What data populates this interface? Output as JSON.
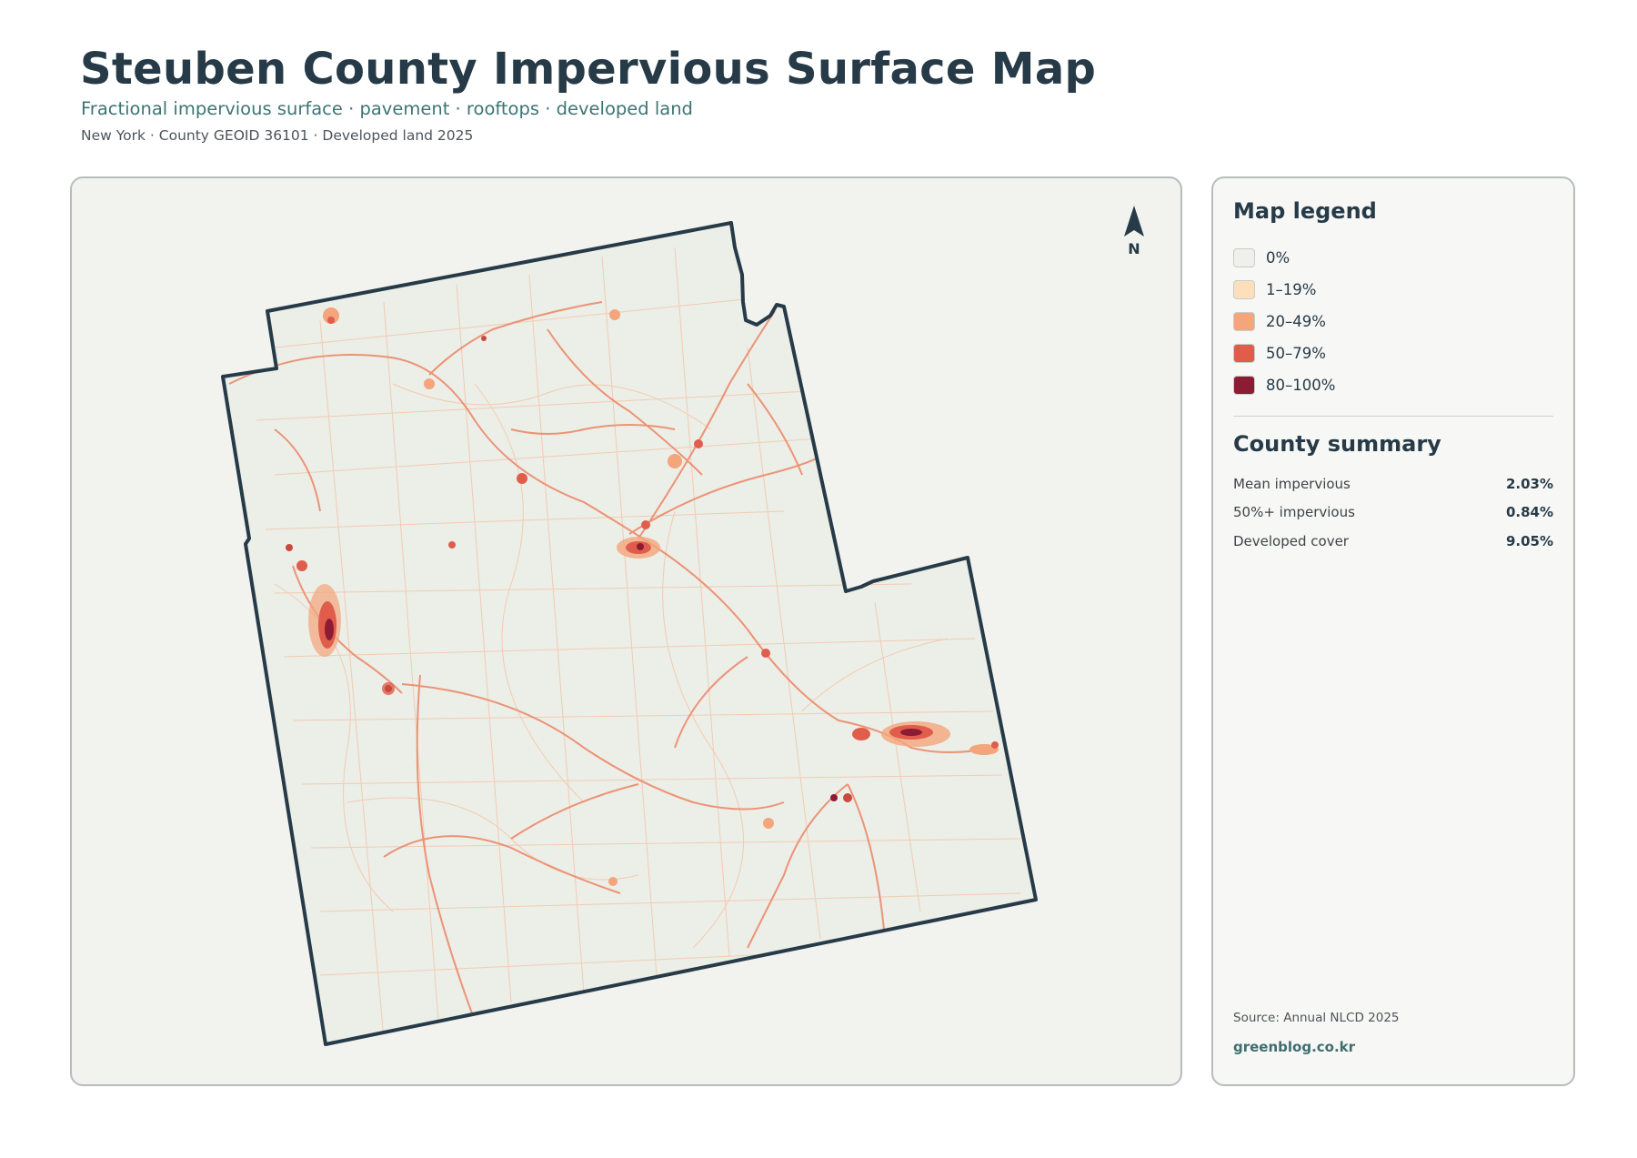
{
  "header": {
    "title": "Steuben County Impervious Surface Map",
    "subtitle": "Fractional impervious surface · pavement · rooftops · developed land",
    "meta": "New York · County GEOID 36101 · Developed land 2025"
  },
  "map": {
    "north_label": "N",
    "colors": {
      "outline": "#263a47",
      "land": "#eceee8",
      "road_light": "#f2b48c",
      "road_mid": "#e8775a",
      "urban": "#c9493c",
      "urban_core": "#8e1f33"
    }
  },
  "legend": {
    "title": "Map legend",
    "items": [
      {
        "label": "0%",
        "color": "#efefec"
      },
      {
        "label": "1–19%",
        "color": "#fde0bb"
      },
      {
        "label": "20–49%",
        "color": "#f4a57b"
      },
      {
        "label": "50–79%",
        "color": "#e05d4c"
      },
      {
        "label": "80–100%",
        "color": "#8c1c33"
      }
    ]
  },
  "summary": {
    "title": "County summary",
    "rows": [
      {
        "label": "Mean impervious",
        "value": "2.03%"
      },
      {
        "label": "50%+ impervious",
        "value": "0.84%"
      },
      {
        "label": "Developed cover",
        "value": "9.05%"
      }
    ]
  },
  "footer": {
    "source": "Source: Annual NLCD 2025",
    "brand": "greenblog.co.kr"
  }
}
